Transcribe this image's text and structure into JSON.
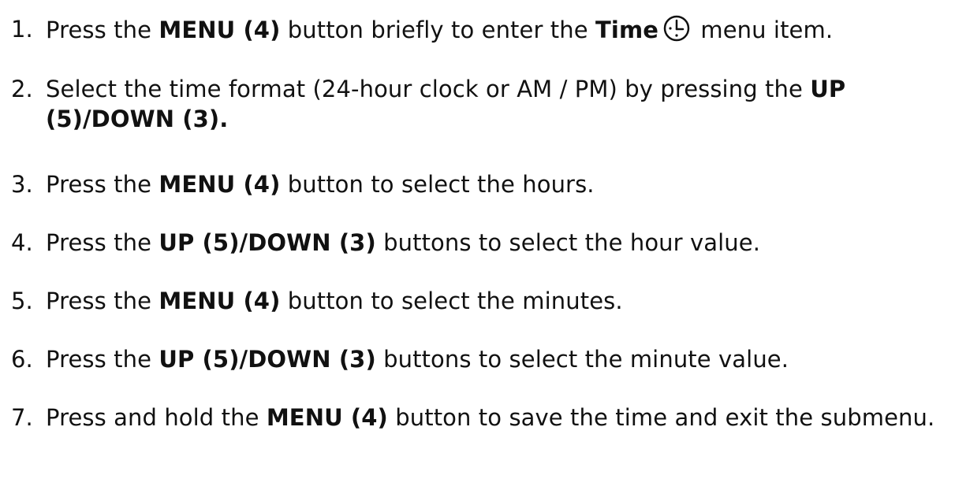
{
  "steps": [
    {
      "number": "1.",
      "parts": [
        "Press the ",
        "MENU (4)",
        " button briefly to enter the ",
        "Time",
        " menu item."
      ],
      "icon": "clock-icon"
    },
    {
      "number": "2.",
      "parts": [
        "Select the time format (24-hour clock or AM / PM) by pressing the ",
        "UP (5)/DOWN (3)."
      ]
    },
    {
      "number": "3.",
      "parts": [
        "Press the ",
        "MENU (4)",
        " button to select the hours."
      ]
    },
    {
      "number": "4.",
      "parts": [
        "Press the ",
        "UP (5)/DOWN (3)",
        " buttons to select the hour value."
      ]
    },
    {
      "number": "5.",
      "parts": [
        "Press the ",
        "MENU (4)",
        " button to select the minutes."
      ]
    },
    {
      "number": "6.",
      "parts": [
        "Press the ",
        "UP (5)/DOWN (3)",
        " buttons to select the minute value."
      ]
    },
    {
      "number": "7.",
      "parts": [
        "Press and hold the ",
        "MENU (4)",
        " button to save the time and exit the submenu."
      ]
    }
  ]
}
